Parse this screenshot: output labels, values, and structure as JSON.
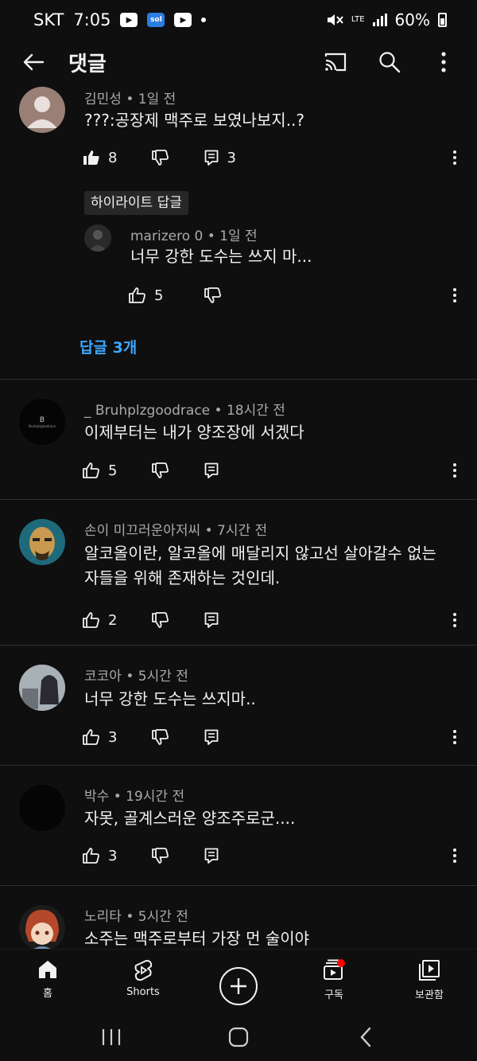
{
  "status_bar": {
    "carrier": "SKT",
    "time": "7:05",
    "apps": [
      "youtube",
      "sol",
      "youtube"
    ],
    "network": "LTE",
    "battery": "60%"
  },
  "header": {
    "title": "댓글",
    "icons": [
      "back-arrow",
      "cast",
      "search",
      "more-vertical"
    ]
  },
  "comments": [
    {
      "author": "김민성",
      "age": "1일 전",
      "text": "???:공장제 맥주로 보였나보지..?",
      "likes": "8",
      "liked": true,
      "replies_count": "3",
      "highlight_label": "하이라이트 답글",
      "highlight_reply": {
        "author": "marizero 0",
        "age": "1일 전",
        "text": "너무 강한 도수는 쓰지 마...",
        "likes": "5"
      },
      "replies_link": "답글 3개"
    },
    {
      "author": "_ Bruhplzgoodrace",
      "age": "18시간 전",
      "text": "이제부터는 내가 양조장에 서겠다",
      "likes": "5",
      "avatar_text": "B",
      "avatar_subtext": "Bruhplzgoodrace"
    },
    {
      "author": "손이 미끄러운아저씨",
      "age": "7시간 전",
      "text": "알코올이란, 알코올에 매달리지 않고선 살아갈수 없는 자들을 위해 존재하는 것인데.",
      "likes": "2"
    },
    {
      "author": "코코아",
      "age": "5시간 전",
      "text": "너무 강한 도수는 쓰지마..",
      "likes": "3"
    },
    {
      "author": "박수",
      "age": "19시간 전",
      "text": "자못, 골계스러운 양조주로군....",
      "likes": "3"
    },
    {
      "author": "노리타",
      "age": "5시간 전",
      "text": "소주는 맥주로부터 가장 먼 술이야"
    }
  ],
  "meta_separator": "•",
  "bottom_nav": [
    {
      "label": "홈",
      "icon": "home"
    },
    {
      "label": "Shorts",
      "icon": "shorts"
    },
    {
      "label": "",
      "icon": "add"
    },
    {
      "label": "구독",
      "icon": "subscriptions"
    },
    {
      "label": "보관함",
      "icon": "library"
    }
  ],
  "colors": {
    "background": "#0f0f0f",
    "link": "#3ea6ff",
    "meta_text": "#aaaaaa",
    "notification_dot": "#ff0000"
  }
}
